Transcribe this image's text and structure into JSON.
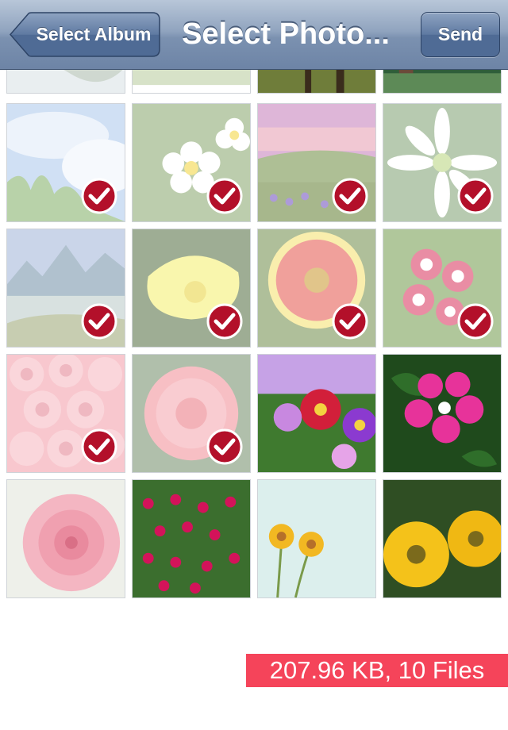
{
  "nav": {
    "title": "Select Photo...",
    "back_label": "Select Album",
    "send_label": "Send"
  },
  "photos": [
    {
      "subject": "waterfall-landscape",
      "selected": false
    },
    {
      "subject": "forest-road",
      "selected": false
    },
    {
      "subject": "forest-path",
      "selected": false
    },
    {
      "subject": "mountain-stream",
      "selected": false
    },
    {
      "subject": "sky-clouds",
      "selected": true
    },
    {
      "subject": "white-flowers",
      "selected": true
    },
    {
      "subject": "purple-sunset-field",
      "selected": true
    },
    {
      "subject": "white-star-flower",
      "selected": true
    },
    {
      "subject": "river-mountains",
      "selected": true
    },
    {
      "subject": "yellow-flower",
      "selected": true
    },
    {
      "subject": "red-yellow-daisy",
      "selected": true
    },
    {
      "subject": "pink-dianthus",
      "selected": true
    },
    {
      "subject": "pink-roses",
      "selected": true
    },
    {
      "subject": "pink-pom-flower",
      "selected": true
    },
    {
      "subject": "flower-field-illustration",
      "selected": false
    },
    {
      "subject": "pink-periwinkle",
      "selected": false
    },
    {
      "subject": "pink-rose",
      "selected": false
    },
    {
      "subject": "crimson-buds",
      "selected": false
    },
    {
      "subject": "yellow-daisies",
      "selected": false
    },
    {
      "subject": "yellow-zinnias",
      "selected": false
    }
  ],
  "status": {
    "text": "207.96 KB, 10 Files"
  },
  "colors": {
    "nav_bar": "#7b91b0",
    "status_pill": "#f5445a",
    "check_badge": "#b3102a"
  }
}
